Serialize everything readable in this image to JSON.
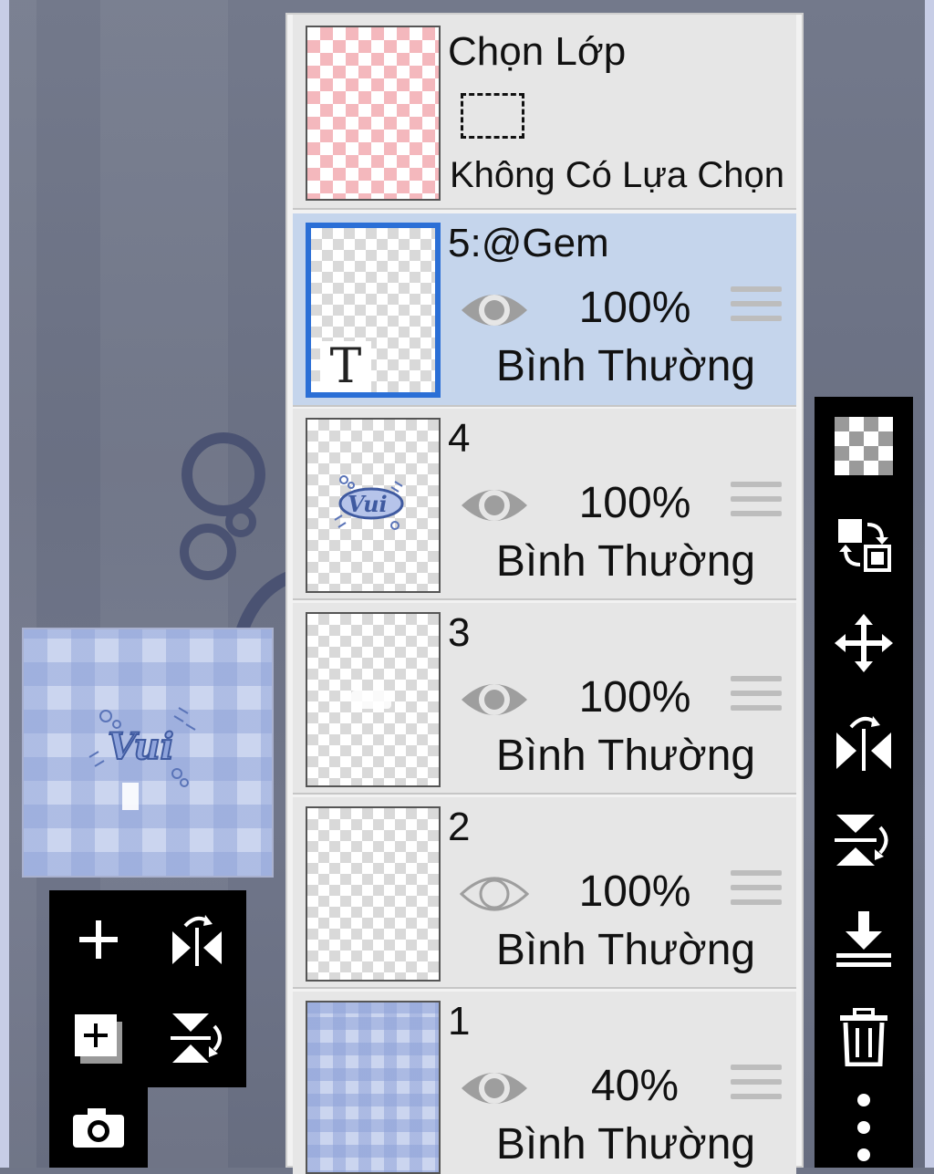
{
  "selection_layer": {
    "title": "Chọn Lớp",
    "status": "Không Có Lựa Chọn"
  },
  "layers": [
    {
      "name": "5:@Gem",
      "opacity": "100%",
      "blend": "Bình Thường",
      "visible": true,
      "selected": true,
      "thumb_icon": "T"
    },
    {
      "name": "4",
      "opacity": "100%",
      "blend": "Bình Thường",
      "visible": true,
      "selected": false
    },
    {
      "name": "3",
      "opacity": "100%",
      "blend": "Bình Thường",
      "visible": true,
      "selected": false
    },
    {
      "name": "2",
      "opacity": "100%",
      "blend": "Bình Thường",
      "visible": false,
      "selected": false
    },
    {
      "name": "1",
      "opacity": "40%",
      "blend": "Bình Thường",
      "visible": true,
      "selected": false
    }
  ],
  "preview": {
    "logo_text": "Vui"
  },
  "left_tools": [
    "add-layer-icon",
    "flip-horizontal-icon",
    "add-copy-layer-icon",
    "flip-vertical-icon",
    "camera-icon"
  ],
  "right_tools": [
    "transparency-icon",
    "swap-layers-icon",
    "move-icon",
    "flip-horizontal-icon",
    "flip-vertical-icon",
    "merge-down-icon",
    "trash-icon",
    "more-icon"
  ],
  "colors": {
    "selected_row": "#c5d5ec",
    "selected_border": "#2b6fd6",
    "toolbar": "#000000",
    "selection_thumb": "#f4b8bd"
  }
}
